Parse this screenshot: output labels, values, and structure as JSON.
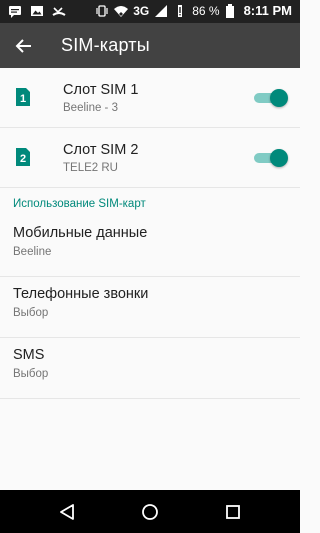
{
  "statusbar": {
    "left_icons": [
      "notification-message-icon",
      "image-icon",
      "missed-call-icon"
    ],
    "network": "3G",
    "battery_percent": "86 %",
    "time": "8:11 PM"
  },
  "appbar": {
    "title": "SIM-карты"
  },
  "sims": [
    {
      "number": "1",
      "title": "Слот SIM 1",
      "subtitle": "Beeline - 3",
      "enabled": true
    },
    {
      "number": "2",
      "title": "Слот SIM 2",
      "subtitle": "TELE2 RU",
      "enabled": true
    }
  ],
  "section": {
    "header": "Использование SIM-карт"
  },
  "prefs": [
    {
      "title": "Мобильные данные",
      "subtitle": "Beeline"
    },
    {
      "title": "Телефонные звонки",
      "subtitle": "Выбор"
    },
    {
      "title": "SMS",
      "subtitle": "Выбор"
    }
  ],
  "colors": {
    "accent": "#00897b",
    "accent_light": "#80cbc4",
    "appbar": "#424242",
    "statusbar": "#212121"
  }
}
